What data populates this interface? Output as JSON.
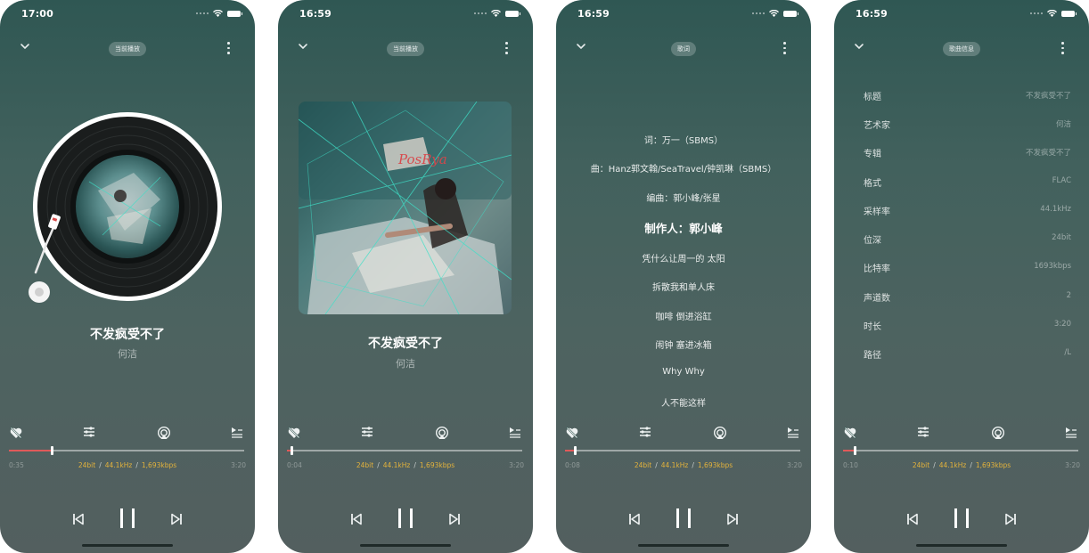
{
  "colors": {
    "accent": "#e3b23c",
    "progress_fill": "#e05a5a",
    "bg_top": "#2f5753",
    "bg_bottom": "#535f5f"
  },
  "icons": [
    "chevron-down-icon",
    "more-vertical-icon",
    "heart-off-icon",
    "equalizer-icon",
    "airplay-icon",
    "play-next-queue-icon",
    "previous-icon",
    "pause-icon",
    "next-icon",
    "wifi-icon",
    "battery-icon"
  ],
  "screens": [
    {
      "status_time": "17:00",
      "tab_label": "当前播放",
      "title": "不发疯受不了",
      "artist": "何洁",
      "elapsed": "0:35",
      "total": "3:20",
      "progress": 0.18,
      "format": {
        "bit": "24bit",
        "rate": "44.1kHz",
        "bitrate": "1,693kbps"
      }
    },
    {
      "status_time": "16:59",
      "tab_label": "当前播放",
      "title": "不发疯受不了",
      "artist": "何洁",
      "elapsed": "0:04",
      "total": "3:20",
      "progress": 0.02,
      "format": {
        "bit": "24bit",
        "rate": "44.1kHz",
        "bitrate": "1,693kbps"
      }
    },
    {
      "status_time": "16:59",
      "tab_label": "歌词",
      "elapsed": "0:08",
      "total": "3:20",
      "progress": 0.04,
      "format": {
        "bit": "24bit",
        "rate": "44.1kHz",
        "bitrate": "1,693kbps"
      },
      "lyrics": [
        "词：万一（SBMS）",
        "曲：Hanz郭文翰/SeaTravel/钟凯琳（SBMS）",
        "编曲：郭小峰/张星",
        "制作人：郭小峰",
        "凭什么让周一的 太阳",
        "拆散我和单人床",
        "咖啡 倒进浴缸",
        "闹钟 塞进冰箱",
        "Why Why",
        "人不能这样"
      ],
      "active_lyric_index": 3
    },
    {
      "status_time": "16:59",
      "tab_label": "歌曲信息",
      "elapsed": "0:10",
      "total": "3:20",
      "progress": 0.05,
      "format": {
        "bit": "24bit",
        "rate": "44.1kHz",
        "bitrate": "1,693kbps"
      },
      "info": [
        {
          "key": "标题",
          "value": "不发疯受不了"
        },
        {
          "key": "艺术家",
          "value": "何洁"
        },
        {
          "key": "专辑",
          "value": "不发疯受不了"
        },
        {
          "key": "格式",
          "value": "FLAC"
        },
        {
          "key": "采样率",
          "value": "44.1kHz"
        },
        {
          "key": "位深",
          "value": "24bit"
        },
        {
          "key": "比特率",
          "value": "1693kbps"
        },
        {
          "key": "声道数",
          "value": "2"
        },
        {
          "key": "时长",
          "value": "3:20"
        },
        {
          "key": "路径",
          "value": "/L"
        }
      ]
    }
  ]
}
